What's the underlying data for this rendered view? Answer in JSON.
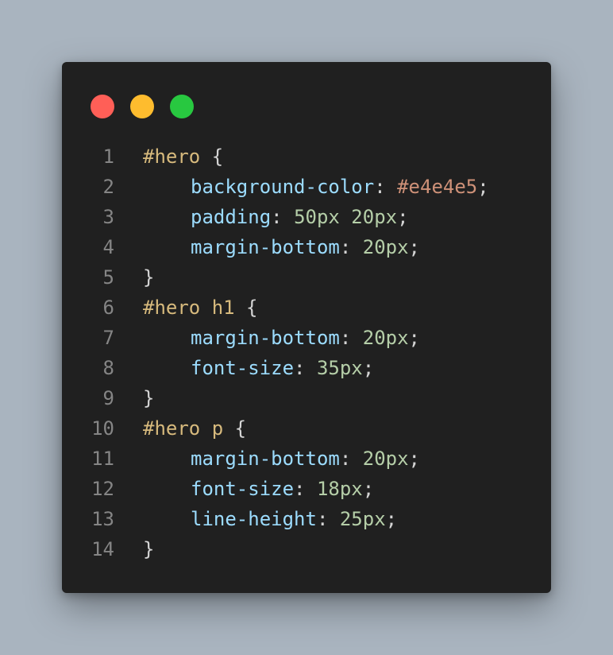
{
  "window": {
    "traffic_lights": [
      {
        "name": "close",
        "color": "#ff5f57"
      },
      {
        "name": "minimize",
        "color": "#febc2e"
      },
      {
        "name": "maximize",
        "color": "#28c840"
      }
    ]
  },
  "colors": {
    "selector": "#d7ba7d",
    "brace": "#d4d4d4",
    "property": "#9cdcfe",
    "punct": "#d4d4d4",
    "number": "#b5cea8",
    "hex": "#ce9178"
  },
  "code_lines": [
    {
      "num": "1",
      "indent": 0,
      "tokens": [
        {
          "t": "#hero",
          "k": "selector"
        },
        {
          "t": " {",
          "k": "brace"
        }
      ]
    },
    {
      "num": "2",
      "indent": 1,
      "tokens": [
        {
          "t": "background-color",
          "k": "property"
        },
        {
          "t": ": ",
          "k": "punct"
        },
        {
          "t": "#e4e4e5",
          "k": "hex"
        },
        {
          "t": ";",
          "k": "punct"
        }
      ]
    },
    {
      "num": "3",
      "indent": 1,
      "tokens": [
        {
          "t": "padding",
          "k": "property"
        },
        {
          "t": ": ",
          "k": "punct"
        },
        {
          "t": "50px 20px",
          "k": "number"
        },
        {
          "t": ";",
          "k": "punct"
        }
      ]
    },
    {
      "num": "4",
      "indent": 1,
      "tokens": [
        {
          "t": "margin-bottom",
          "k": "property"
        },
        {
          "t": ": ",
          "k": "punct"
        },
        {
          "t": "20px",
          "k": "number"
        },
        {
          "t": ";",
          "k": "punct"
        }
      ]
    },
    {
      "num": "5",
      "indent": 0,
      "tokens": [
        {
          "t": "}",
          "k": "brace"
        }
      ]
    },
    {
      "num": "6",
      "indent": 0,
      "tokens": [
        {
          "t": "#hero h1",
          "k": "selector"
        },
        {
          "t": " {",
          "k": "brace"
        }
      ]
    },
    {
      "num": "7",
      "indent": 1,
      "tokens": [
        {
          "t": "margin-bottom",
          "k": "property"
        },
        {
          "t": ": ",
          "k": "punct"
        },
        {
          "t": "20px",
          "k": "number"
        },
        {
          "t": ";",
          "k": "punct"
        }
      ]
    },
    {
      "num": "8",
      "indent": 1,
      "tokens": [
        {
          "t": "font-size",
          "k": "property"
        },
        {
          "t": ": ",
          "k": "punct"
        },
        {
          "t": "35px",
          "k": "number"
        },
        {
          "t": ";",
          "k": "punct"
        }
      ]
    },
    {
      "num": "9",
      "indent": 0,
      "tokens": [
        {
          "t": "}",
          "k": "brace"
        }
      ]
    },
    {
      "num": "10",
      "indent": 0,
      "tokens": [
        {
          "t": "#hero p",
          "k": "selector"
        },
        {
          "t": " {",
          "k": "brace"
        }
      ]
    },
    {
      "num": "11",
      "indent": 1,
      "tokens": [
        {
          "t": "margin-bottom",
          "k": "property"
        },
        {
          "t": ": ",
          "k": "punct"
        },
        {
          "t": "20px",
          "k": "number"
        },
        {
          "t": ";",
          "k": "punct"
        }
      ]
    },
    {
      "num": "12",
      "indent": 1,
      "tokens": [
        {
          "t": "font-size",
          "k": "property"
        },
        {
          "t": ": ",
          "k": "punct"
        },
        {
          "t": "18px",
          "k": "number"
        },
        {
          "t": ";",
          "k": "punct"
        }
      ]
    },
    {
      "num": "13",
      "indent": 1,
      "tokens": [
        {
          "t": "line-height",
          "k": "property"
        },
        {
          "t": ": ",
          "k": "punct"
        },
        {
          "t": "25px",
          "k": "number"
        },
        {
          "t": ";",
          "k": "punct"
        }
      ]
    },
    {
      "num": "14",
      "indent": 0,
      "tokens": [
        {
          "t": "}",
          "k": "brace"
        }
      ]
    }
  ]
}
